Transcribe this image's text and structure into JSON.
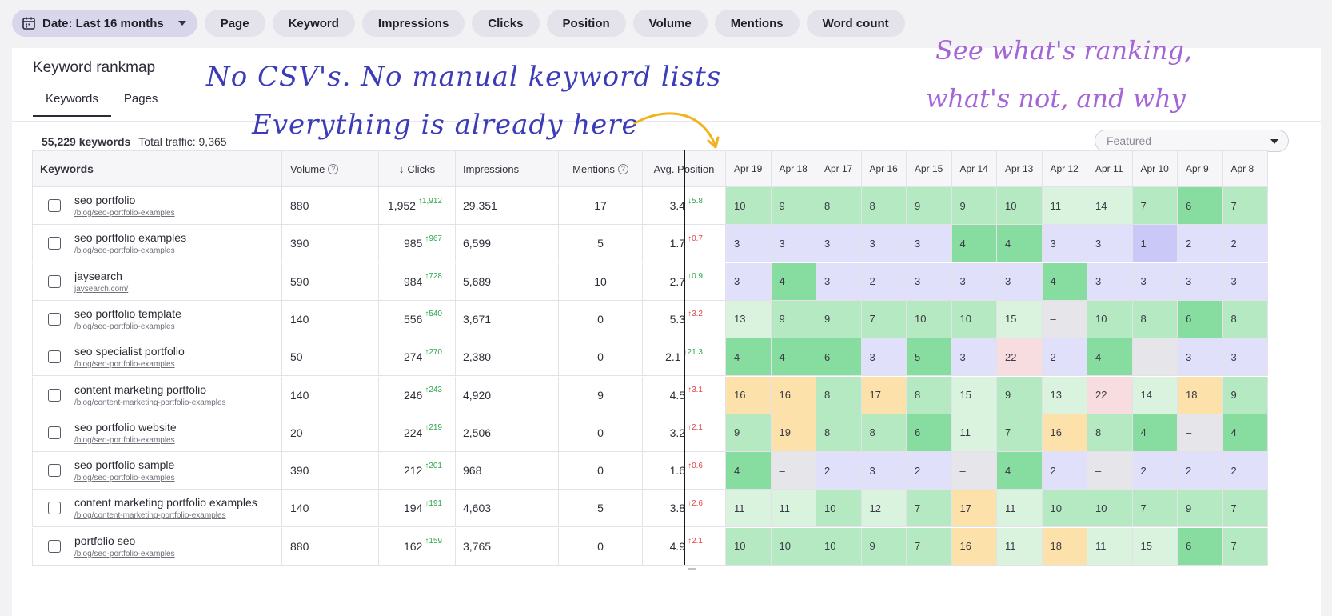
{
  "filters": [
    {
      "label": "Date: Last 16 months",
      "icon": "calendar-icon",
      "dropdown": true
    },
    {
      "label": "Page"
    },
    {
      "label": "Keyword"
    },
    {
      "label": "Impressions"
    },
    {
      "label": "Clicks"
    },
    {
      "label": "Position"
    },
    {
      "label": "Volume"
    },
    {
      "label": "Mentions"
    },
    {
      "label": "Word count"
    }
  ],
  "panel": {
    "title": "Keyword rankmap",
    "tabs": [
      "Keywords",
      "Pages"
    ],
    "active_tab": "Keywords",
    "summary_count": "55,229 keywords",
    "summary_traffic": "Total traffic: 9,365",
    "sort_select": "Featured"
  },
  "annotations": {
    "line1": "No CSV's. No manual keyword lists",
    "line2": "Everything is already here",
    "line3": "See what's ranking,",
    "line4": "what's not, and why"
  },
  "table": {
    "headers": {
      "keywords": "Keywords",
      "volume": "Volume",
      "clicks": "Clicks",
      "impressions": "Impressions",
      "mentions": "Mentions",
      "avg_position": "Avg. Position"
    },
    "dates": [
      "Apr 19",
      "Apr 18",
      "Apr 17",
      "Apr 16",
      "Apr 15",
      "Apr 14",
      "Apr 13",
      "Apr 12",
      "Apr 11",
      "Apr 10",
      "Apr 9",
      "Apr 8"
    ],
    "rows": [
      {
        "keyword": "seo portfolio",
        "url": "/blog/seo-portfolio-examples",
        "volume": "880",
        "clicks": "1,952",
        "clicks_delta": "1,912",
        "clicks_dir": "up",
        "impressions": "29,351",
        "mentions": "17",
        "position": "3.4",
        "pos_delta": "5.8",
        "pos_dir": "down-good",
        "ranks": [
          "10",
          "9",
          "8",
          "8",
          "9",
          "9",
          "10",
          "11",
          "14",
          "7",
          "6",
          "7"
        ],
        "tones": [
          "g2",
          "g2",
          "g2",
          "g2",
          "g2",
          "g2",
          "g2",
          "g3",
          "g3",
          "g2",
          "g1",
          "g2"
        ]
      },
      {
        "keyword": "seo portfolio examples",
        "url": "/blog/seo-portfolio-examples",
        "volume": "390",
        "clicks": "985",
        "clicks_delta": "967",
        "clicks_dir": "up",
        "impressions": "6,599",
        "mentions": "5",
        "position": "1.7",
        "pos_delta": "0.7",
        "pos_dir": "up-bad",
        "ranks": [
          "3",
          "3",
          "3",
          "3",
          "3",
          "4",
          "4",
          "3",
          "3",
          "1",
          "2",
          "2"
        ],
        "tones": [
          "pu",
          "pu",
          "pu",
          "pu",
          "pu",
          "g1",
          "g1",
          "pu",
          "pu",
          "pu2",
          "pu",
          "pu"
        ]
      },
      {
        "keyword": "jaysearch",
        "url": "jaysearch.com/",
        "volume": "590",
        "clicks": "984",
        "clicks_delta": "728",
        "clicks_dir": "up",
        "impressions": "5,689",
        "mentions": "10",
        "position": "2.7",
        "pos_delta": "0.9",
        "pos_dir": "down-good",
        "ranks": [
          "3",
          "4",
          "3",
          "2",
          "3",
          "3",
          "3",
          "4",
          "3",
          "3",
          "3",
          "3"
        ],
        "tones": [
          "pu",
          "g1",
          "pu",
          "pu",
          "pu",
          "pu",
          "pu",
          "g1",
          "pu",
          "pu",
          "pu",
          "pu"
        ]
      },
      {
        "keyword": "seo portfolio template",
        "url": "/blog/seo-portfolio-examples",
        "volume": "140",
        "clicks": "556",
        "clicks_delta": "540",
        "clicks_dir": "up",
        "impressions": "3,671",
        "mentions": "0",
        "position": "5.3",
        "pos_delta": "3.2",
        "pos_dir": "up-bad",
        "ranks": [
          "13",
          "9",
          "9",
          "7",
          "10",
          "10",
          "15",
          "–",
          "10",
          "8",
          "6",
          "8"
        ],
        "tones": [
          "g3",
          "g2",
          "g2",
          "g2",
          "g2",
          "g2",
          "g3",
          "gr",
          "g2",
          "g2",
          "g1",
          "g2"
        ]
      },
      {
        "keyword": "seo specialist portfolio",
        "url": "/blog/seo-portfolio-examples",
        "volume": "50",
        "clicks": "274",
        "clicks_delta": "270",
        "clicks_dir": "up",
        "impressions": "2,380",
        "mentions": "0",
        "position": "2.1",
        "pos_delta": "21.3",
        "pos_dir": "down-good",
        "ranks": [
          "4",
          "4",
          "6",
          "3",
          "5",
          "3",
          "22",
          "2",
          "4",
          "–",
          "3",
          "3"
        ],
        "tones": [
          "g1",
          "g1",
          "g1",
          "pu",
          "g1",
          "pu",
          "pk",
          "pu",
          "g1",
          "gr",
          "pu",
          "pu"
        ]
      },
      {
        "keyword": "content marketing portfolio",
        "url": "/blog/content-marketing-portfolio-examples",
        "volume": "140",
        "clicks": "246",
        "clicks_delta": "243",
        "clicks_dir": "up",
        "impressions": "4,920",
        "mentions": "9",
        "position": "4.5",
        "pos_delta": "3.1",
        "pos_dir": "up-bad",
        "ranks": [
          "16",
          "16",
          "8",
          "17",
          "8",
          "15",
          "9",
          "13",
          "22",
          "14",
          "18",
          "9"
        ],
        "tones": [
          "or",
          "or",
          "g2",
          "or",
          "g2",
          "g3",
          "g2",
          "g3",
          "pk",
          "g3",
          "or",
          "g2"
        ]
      },
      {
        "keyword": "seo portfolio website",
        "url": "/blog/seo-portfolio-examples",
        "volume": "20",
        "clicks": "224",
        "clicks_delta": "219",
        "clicks_dir": "up",
        "impressions": "2,506",
        "mentions": "0",
        "position": "3.2",
        "pos_delta": "2.1",
        "pos_dir": "up-bad",
        "ranks": [
          "9",
          "19",
          "8",
          "8",
          "6",
          "11",
          "7",
          "16",
          "8",
          "4",
          "–",
          "4"
        ],
        "tones": [
          "g2",
          "or",
          "g2",
          "g2",
          "g1",
          "g3",
          "g2",
          "or",
          "g2",
          "g1",
          "gr",
          "g1"
        ]
      },
      {
        "keyword": "seo portfolio sample",
        "url": "/blog/seo-portfolio-examples",
        "volume": "390",
        "clicks": "212",
        "clicks_delta": "201",
        "clicks_dir": "up",
        "impressions": "968",
        "mentions": "0",
        "position": "1.6",
        "pos_delta": "0.6",
        "pos_dir": "up-bad",
        "ranks": [
          "4",
          "–",
          "2",
          "3",
          "2",
          "–",
          "4",
          "2",
          "–",
          "2",
          "2",
          "2"
        ],
        "tones": [
          "g1",
          "gr",
          "pu",
          "pu",
          "pu",
          "gr",
          "g1",
          "pu",
          "gr",
          "pu",
          "pu",
          "pu"
        ]
      },
      {
        "keyword": "content marketing portfolio examples",
        "url": "/blog/content-marketing-portfolio-examples",
        "volume": "140",
        "clicks": "194",
        "clicks_delta": "191",
        "clicks_dir": "up",
        "impressions": "4,603",
        "mentions": "5",
        "position": "3.8",
        "pos_delta": "2.6",
        "pos_dir": "up-bad",
        "ranks": [
          "11",
          "11",
          "10",
          "12",
          "7",
          "17",
          "11",
          "10",
          "10",
          "7",
          "9",
          "7"
        ],
        "tones": [
          "g3",
          "g3",
          "g2",
          "g3",
          "g2",
          "or",
          "g3",
          "g2",
          "g2",
          "g2",
          "g2",
          "g2"
        ]
      },
      {
        "keyword": "portfolio seo",
        "url": "/blog/seo-portfolio-examples",
        "volume": "880",
        "clicks": "162",
        "clicks_delta": "159",
        "clicks_dir": "up",
        "impressions": "3,765",
        "mentions": "0",
        "position": "4.9",
        "pos_delta": "2.1",
        "pos_dir": "up-bad",
        "ranks": [
          "10",
          "10",
          "10",
          "9",
          "7",
          "16",
          "11",
          "18",
          "11",
          "15",
          "6",
          "7"
        ],
        "tones": [
          "g2",
          "g2",
          "g2",
          "g2",
          "g2",
          "or",
          "g3",
          "or",
          "g3",
          "g3",
          "g1",
          "g2"
        ]
      }
    ]
  }
}
